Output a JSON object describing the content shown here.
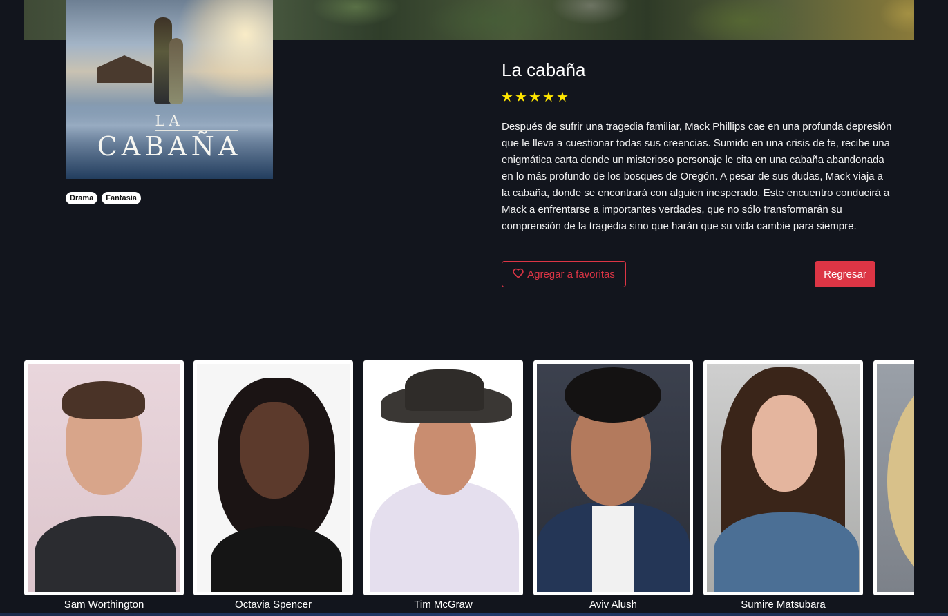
{
  "movie": {
    "title": "La cabaña",
    "poster_title_line1": "LA",
    "poster_title_line2": "CABAÑA",
    "rating_stars": 5,
    "star_glyph": "★",
    "genres": [
      "Drama",
      "Fantasía"
    ],
    "description": "Después de sufrir una tragedia familiar, Mack Phillips cae en una profunda depresión que le lleva a cuestionar todas sus creencias. Sumido en una crisis de fe, recibe una enigmática carta donde un misterioso personaje le cita en una cabaña abandonada en lo más profundo de los bosques de Oregón. A pesar de sus dudas, Mack viaja a la cabaña, donde se encontrará con alguien inesperado. Este encuentro conducirá a Mack a enfrentarse a importantes verdades, que no sólo transformarán su comprensión de la tragedia sino que harán que su vida cambie para siempre."
  },
  "actions": {
    "favorite_label": "Agregar a favoritas",
    "favorite_icon": "heart-outline-icon",
    "back_label": "Regresar"
  },
  "cast": [
    {
      "name": "Sam Worthington"
    },
    {
      "name": "Octavia Spencer"
    },
    {
      "name": "Tim McGraw"
    },
    {
      "name": "Aviv Alush"
    },
    {
      "name": "Sumire Matsubara"
    },
    {
      "name": ""
    }
  ],
  "colors": {
    "background": "#12151d",
    "accent_red": "#dc3545",
    "star_yellow": "#ffe600"
  }
}
